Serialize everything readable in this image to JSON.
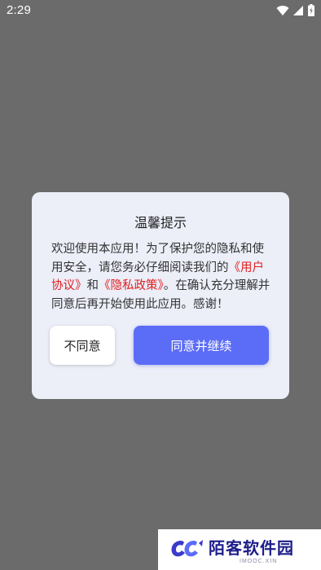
{
  "status_bar": {
    "time": "2:29",
    "icons": [
      "wifi-icon",
      "cell-signal-icon",
      "battery-icon"
    ]
  },
  "dialog": {
    "title": "温馨提示",
    "body": {
      "part1": "欢迎使用本应用！为了保护您的隐私和使用安全，请您务必仔细阅读我们的",
      "user_agreement_link": "《用户协议》",
      "conjunction": "和",
      "privacy_policy_link": "《隐私政策》",
      "part2": "。在确认充分理解并同意后再开始使用此应用。感谢！"
    },
    "disagree_label": "不同意",
    "agree_label": "同意并继续"
  },
  "watermark": {
    "text": "陌客软件园",
    "subtext": "IMOOC.XIN"
  },
  "colors": {
    "overlay": "#6b6b6b",
    "dialog_bg": "#eceef8",
    "link": "#e02020",
    "primary_button": "#5b6cf7"
  }
}
